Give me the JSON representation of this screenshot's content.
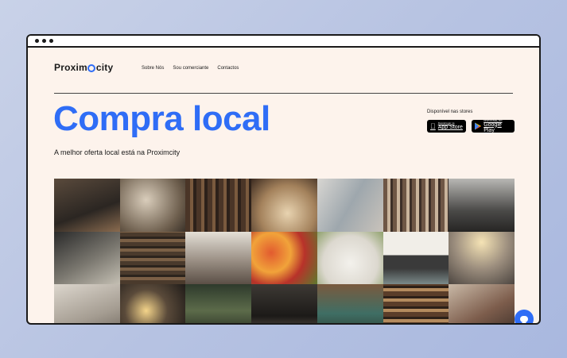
{
  "brand": {
    "logo_text_left": "Proxim",
    "logo_text_right": "city",
    "accent_color": "#2f6df6"
  },
  "nav": {
    "items": [
      "Sobre Nós",
      "Sou comerciante",
      "Contactos"
    ]
  },
  "hero": {
    "title": "Compra local",
    "tagline": "A melhor oferta local está na Proximcity"
  },
  "stores": {
    "label": "Disponível nas stores",
    "app_store": {
      "small": "Descarregar na",
      "big": "App Store",
      "icon": "apple-icon"
    },
    "google_play": {
      "small": "DISPONÍVEL NO",
      "big": "Google Play",
      "icon": "play-icon"
    }
  },
  "gallery": {
    "tiles": [
      "cafe counter",
      "bakery goods",
      "bookshelf shop",
      "pastries with price tags",
      "woman at cafe",
      "clothing rack",
      "boutique interior",
      "chef plating",
      "bookshop aisle",
      "clothing store",
      "fruit market",
      "florist table with scissors",
      "food and drinks storefront",
      "cafe with pendant lights",
      "hands with notebook",
      "hanging bulbs",
      "plant shop",
      "bar interior",
      "market hall",
      "deli shelves",
      "vintage shop"
    ]
  },
  "chat": {
    "icon": "chat-icon"
  }
}
